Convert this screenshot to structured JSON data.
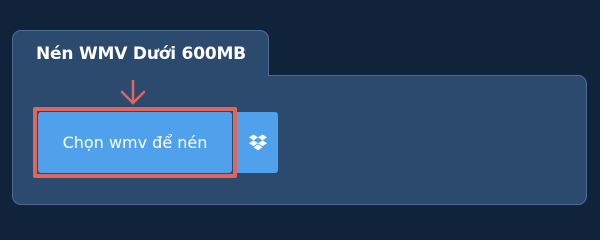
{
  "panel": {
    "title": "Nén WMV Dưới 600MB"
  },
  "upload": {
    "choose_label": "Chọn wmv để nén",
    "dropbox_icon": "dropbox-icon"
  },
  "colors": {
    "background": "#11233a",
    "panel": "#2b4a6e",
    "button": "#4fa1ec",
    "highlight": "#e0665d"
  }
}
